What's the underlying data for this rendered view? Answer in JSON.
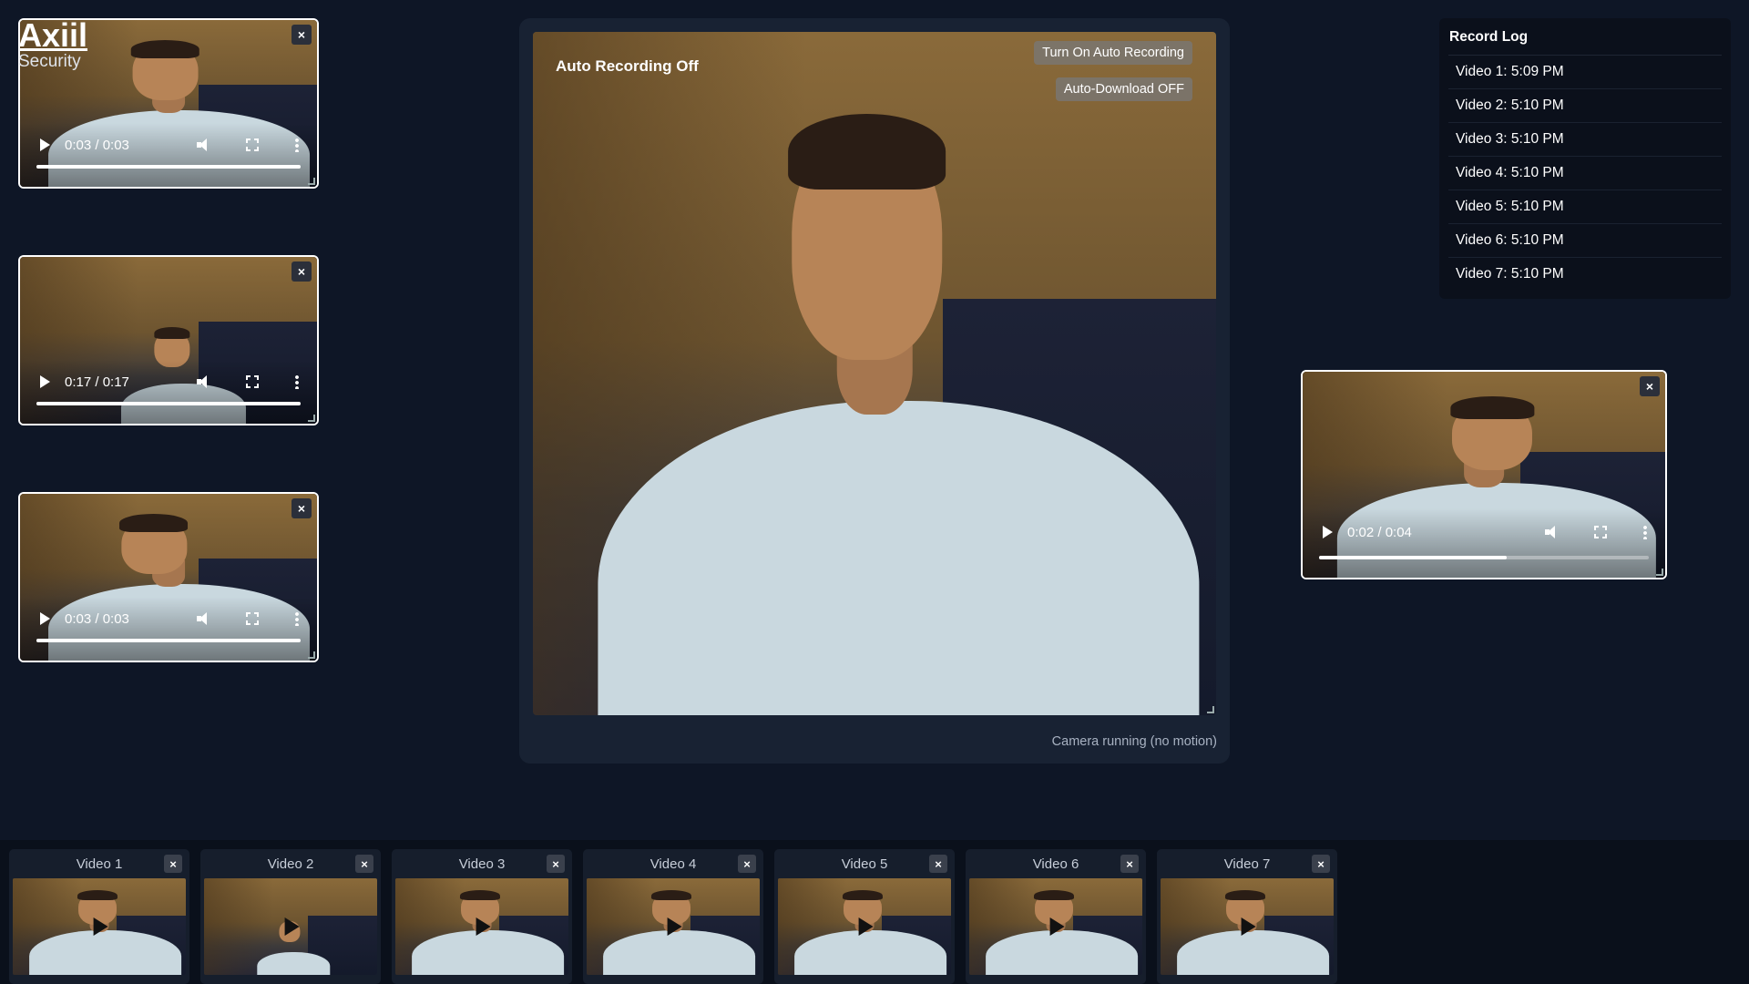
{
  "brand": {
    "name": "Axiil",
    "subtitle": "Security"
  },
  "main": {
    "recording_status": "Auto Recording Off",
    "auto_record_button": "Turn On Auto Recording",
    "auto_download_button": "Auto-Download OFF",
    "camera_status": "Camera running (no motion)"
  },
  "players": [
    {
      "time": "0:03 / 0:03",
      "progress": 1.0
    },
    {
      "time": "0:17 / 0:17",
      "progress": 1.0
    },
    {
      "time": "0:03 / 0:03",
      "progress": 1.0
    },
    {
      "time": "0:02 / 0:04",
      "progress": 0.57
    }
  ],
  "close_glyph": "×",
  "record_log": {
    "title": "Record Log",
    "items": [
      "Video 1: 5:09 PM",
      "Video 2: 5:10 PM",
      "Video 3: 5:10 PM",
      "Video 4: 5:10 PM",
      "Video 5: 5:10 PM",
      "Video 6: 5:10 PM",
      "Video 7: 5:10 PM"
    ]
  },
  "thumbnails": [
    "Video 1",
    "Video 2",
    "Video 3",
    "Video 4",
    "Video 5",
    "Video 6",
    "Video 7"
  ],
  "colors": {
    "background": "#0e1626",
    "panel": "#182233",
    "strip": "#0a101b",
    "button": "#787878"
  }
}
